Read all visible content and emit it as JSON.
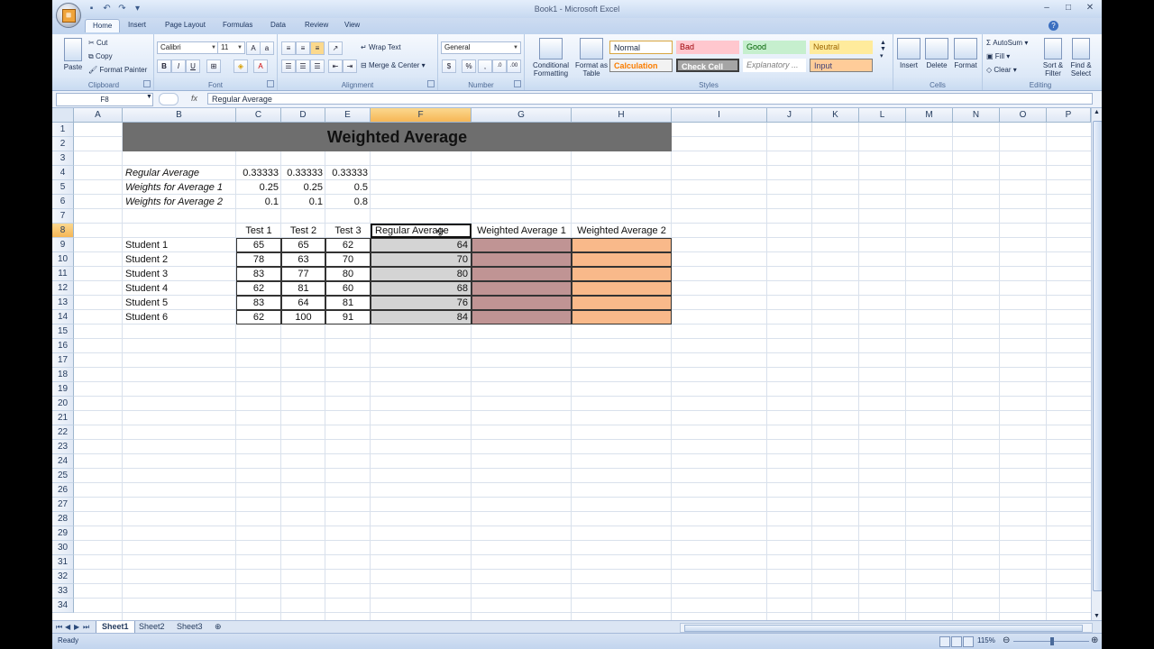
{
  "window": {
    "title": "Book1 - Microsoft Excel"
  },
  "tabs": [
    "Home",
    "Insert",
    "Page Layout",
    "Formulas",
    "Data",
    "Review",
    "View"
  ],
  "ribbon": {
    "clipboard": {
      "label": "Clipboard",
      "paste": "Paste",
      "cut": "Cut",
      "copy": "Copy",
      "format_painter": "Format Painter"
    },
    "font": {
      "label": "Font",
      "name": "Calibri",
      "size": "11",
      "bold": "B",
      "italic": "I",
      "underline": "U"
    },
    "alignment": {
      "label": "Alignment",
      "wrap": "Wrap Text",
      "merge": "Merge & Center"
    },
    "number": {
      "label": "Number",
      "format": "General",
      "currency": "$",
      "percent": "%",
      "comma": ","
    },
    "styles": {
      "label": "Styles",
      "conditional": "Conditional Formatting",
      "format_table": "Format as Table",
      "items": [
        "Normal",
        "Bad",
        "Good",
        "Neutral",
        "Calculation",
        "Check Cell",
        "Explanatory ...",
        "Input"
      ]
    },
    "cells": {
      "label": "Cells",
      "insert": "Insert",
      "delete": "Delete",
      "format": "Format"
    },
    "editing": {
      "label": "Editing",
      "autosum": "AutoSum",
      "fill": "Fill",
      "clear": "Clear",
      "sort": "Sort & Filter",
      "find": "Find & Select"
    }
  },
  "formula_bar": {
    "name_box": "F8",
    "fx": "fx",
    "content": "Regular Average"
  },
  "columns": [
    "A",
    "B",
    "C",
    "D",
    "E",
    "F",
    "G",
    "H",
    "I",
    "J",
    "K",
    "L",
    "M",
    "N",
    "O",
    "P"
  ],
  "rows": [
    "1",
    "2",
    "3",
    "4",
    "5",
    "6",
    "7",
    "8",
    "9",
    "10",
    "11",
    "12",
    "13",
    "14",
    "15",
    "16",
    "17",
    "18",
    "19",
    "20",
    "21",
    "22",
    "23",
    "24",
    "25",
    "26",
    "27",
    "28",
    "29",
    "30",
    "31",
    "32",
    "33",
    "34"
  ],
  "sheet": {
    "title": "Weighted Average",
    "params": [
      {
        "label": "Regular Average",
        "values": [
          "0.33333",
          "0.33333",
          "0.33333"
        ]
      },
      {
        "label": "Weights for Average 1",
        "values": [
          "0.25",
          "0.25",
          "0.5"
        ]
      },
      {
        "label": "Weights for Average 2",
        "values": [
          "0.1",
          "0.1",
          "0.8"
        ]
      }
    ],
    "headers": [
      "Test 1",
      "Test 2",
      "Test 3",
      "Regular Average",
      "Weighted Average 1",
      "Weighted Average 2"
    ],
    "students": [
      {
        "name": "Student 1",
        "scores": [
          "65",
          "65",
          "62"
        ],
        "avg": "64"
      },
      {
        "name": "Student 2",
        "scores": [
          "78",
          "63",
          "70"
        ],
        "avg": "70"
      },
      {
        "name": "Student 3",
        "scores": [
          "83",
          "77",
          "80"
        ],
        "avg": "80"
      },
      {
        "name": "Student 4",
        "scores": [
          "62",
          "81",
          "60"
        ],
        "avg": "68"
      },
      {
        "name": "Student 5",
        "scores": [
          "83",
          "64",
          "81"
        ],
        "avg": "76"
      },
      {
        "name": "Student 6",
        "scores": [
          "62",
          "100",
          "91"
        ],
        "avg": "84"
      }
    ]
  },
  "sheet_tabs": [
    "Sheet1",
    "Sheet2",
    "Sheet3"
  ],
  "status": {
    "text": "Ready",
    "zoom": "115%"
  },
  "colors": {
    "title_fill": "#6e6e6e",
    "avg_fill": "#d4d4d4",
    "w1_fill": "#c09494",
    "w2_fill": "#f9b98a",
    "selection": "#f8c976"
  }
}
